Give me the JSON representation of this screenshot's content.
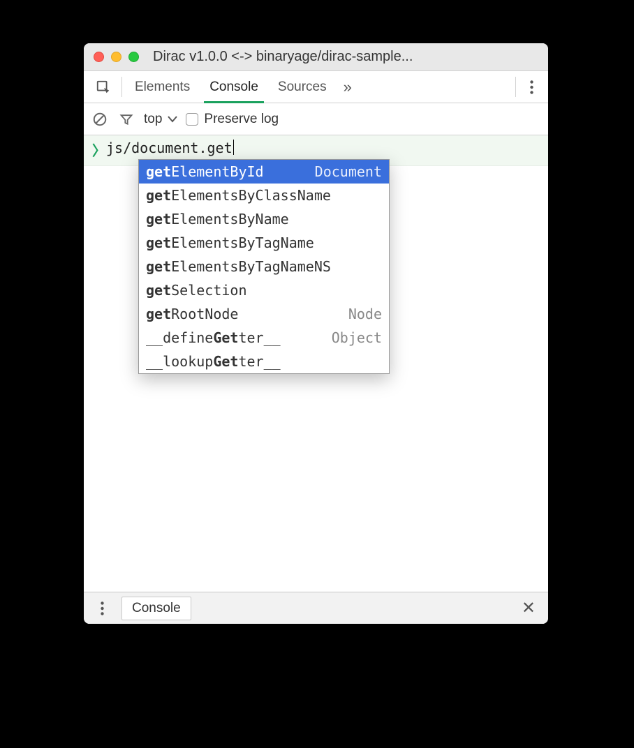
{
  "window": {
    "title": "Dirac v1.0.0 <-> binaryage/dirac-sample..."
  },
  "toolbar": {
    "tabs": [
      "Elements",
      "Console",
      "Sources"
    ],
    "active_tab_index": 1,
    "more_indicator": "»"
  },
  "filterbar": {
    "context": "top",
    "preserve_log_label": "Preserve log",
    "preserve_log_checked": false
  },
  "console": {
    "input": "js/document.get",
    "autocomplete": {
      "selected_index": 0,
      "items": [
        {
          "prefix": "get",
          "rest": "ElementById",
          "type": "Document"
        },
        {
          "prefix": "get",
          "rest": "ElementsByClassName",
          "type": ""
        },
        {
          "prefix": "get",
          "rest": "ElementsByName",
          "type": ""
        },
        {
          "prefix": "get",
          "rest": "ElementsByTagName",
          "type": ""
        },
        {
          "prefix": "get",
          "rest": "ElementsByTagNameNS",
          "type": ""
        },
        {
          "prefix": "get",
          "rest": "Selection",
          "type": ""
        },
        {
          "prefix": "get",
          "rest": "RootNode",
          "type": "Node"
        },
        {
          "pre": "__define",
          "mid": "Get",
          "post": "ter__",
          "type": "Object"
        },
        {
          "pre": "__lookup",
          "mid": "Get",
          "post": "ter__",
          "type": ""
        }
      ]
    }
  },
  "drawer": {
    "tab_label": "Console"
  }
}
